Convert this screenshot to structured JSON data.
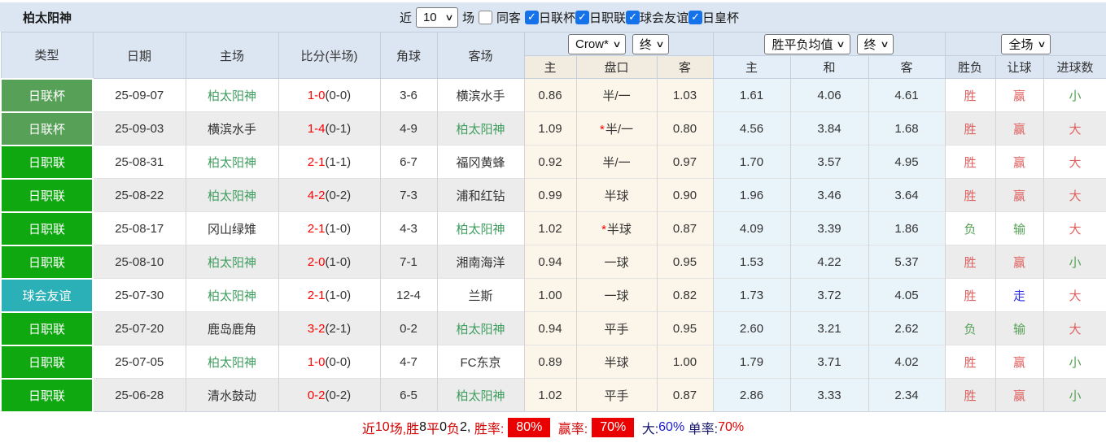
{
  "topbar": {
    "team_title": "柏太阳神",
    "recent_label": "近",
    "recent_value": "10",
    "games_label": "场",
    "same_away_label": "同客",
    "same_away_checked": false,
    "leagues": [
      {
        "label": "日联杯",
        "checked": true
      },
      {
        "label": "日职联",
        "checked": true
      },
      {
        "label": "球会友谊",
        "checked": true
      },
      {
        "label": "日皇杯",
        "checked": true
      }
    ],
    "check_glyph": "✓",
    "chevron_glyph": "∨"
  },
  "header": {
    "col_type": "类型",
    "col_date": "日期",
    "col_home": "主场",
    "col_score": "比分(半场)",
    "col_corner": "角球",
    "col_away": "客场",
    "odds_company_select": "Crow*",
    "odds_time_select": "终",
    "avg_select": "胜平负均值",
    "avg_time_select": "终",
    "result_select": "全场",
    "odds_sub": [
      "主",
      "盘口",
      "客"
    ],
    "avg_sub": [
      "主",
      "和",
      "客"
    ],
    "result_sub": [
      "胜负",
      "让球",
      "进球数"
    ]
  },
  "colors": {
    "type_badges": {
      "日联杯": "#57a057",
      "日职联": "#10a810",
      "球会友谊": "#2ab0b6"
    },
    "subject_team": "#3f9e5f",
    "score_red": "#fe0000",
    "result_red": "#e06060",
    "result_green": "#55a055",
    "result_blue": "#2a2ae0",
    "badge_bg": "#ea0000"
  },
  "rows": [
    {
      "type": "日联杯",
      "date": "25-09-07",
      "home": "柏太阳神",
      "home_subject": true,
      "ft": "1-0",
      "ht": "(0-0)",
      "corner": "3-6",
      "away": "横滨水手",
      "away_subject": false,
      "o1": "0.86",
      "line": "半/一",
      "star": false,
      "o2": "1.03",
      "a1": "1.61",
      "a2": "4.06",
      "a3": "4.61",
      "res": {
        "t": "胜",
        "c": "r"
      },
      "hres": {
        "t": "赢",
        "c": "r"
      },
      "gres": {
        "t": "小",
        "c": "g"
      }
    },
    {
      "type": "日联杯",
      "date": "25-09-03",
      "home": "横滨水手",
      "home_subject": false,
      "ft": "1-4",
      "ht": "(0-1)",
      "corner": "4-9",
      "away": "柏太阳神",
      "away_subject": true,
      "o1": "1.09",
      "line": "半/一",
      "star": true,
      "o2": "0.80",
      "a1": "4.56",
      "a2": "3.84",
      "a3": "1.68",
      "res": {
        "t": "胜",
        "c": "r"
      },
      "hres": {
        "t": "赢",
        "c": "r"
      },
      "gres": {
        "t": "大",
        "c": "r"
      }
    },
    {
      "type": "日职联",
      "date": "25-08-31",
      "home": "柏太阳神",
      "home_subject": true,
      "ft": "2-1",
      "ht": "(1-1)",
      "corner": "6-7",
      "away": "福冈黄蜂",
      "away_subject": false,
      "o1": "0.92",
      "line": "半/一",
      "star": false,
      "o2": "0.97",
      "a1": "1.70",
      "a2": "3.57",
      "a3": "4.95",
      "res": {
        "t": "胜",
        "c": "r"
      },
      "hres": {
        "t": "赢",
        "c": "r"
      },
      "gres": {
        "t": "大",
        "c": "r"
      }
    },
    {
      "type": "日职联",
      "date": "25-08-22",
      "home": "柏太阳神",
      "home_subject": true,
      "ft": "4-2",
      "ht": "(0-2)",
      "corner": "7-3",
      "away": "浦和红钻",
      "away_subject": false,
      "o1": "0.99",
      "line": "半球",
      "star": false,
      "o2": "0.90",
      "a1": "1.96",
      "a2": "3.46",
      "a3": "3.64",
      "res": {
        "t": "胜",
        "c": "r"
      },
      "hres": {
        "t": "赢",
        "c": "r"
      },
      "gres": {
        "t": "大",
        "c": "r"
      }
    },
    {
      "type": "日职联",
      "date": "25-08-17",
      "home": "冈山绿雉",
      "home_subject": false,
      "ft": "2-1",
      "ht": "(1-0)",
      "corner": "4-3",
      "away": "柏太阳神",
      "away_subject": true,
      "o1": "1.02",
      "line": "半球",
      "star": true,
      "o2": "0.87",
      "a1": "4.09",
      "a2": "3.39",
      "a3": "1.86",
      "res": {
        "t": "负",
        "c": "g"
      },
      "hres": {
        "t": "输",
        "c": "g"
      },
      "gres": {
        "t": "大",
        "c": "r"
      }
    },
    {
      "type": "日职联",
      "date": "25-08-10",
      "home": "柏太阳神",
      "home_subject": true,
      "ft": "2-0",
      "ht": "(1-0)",
      "corner": "7-1",
      "away": "湘南海洋",
      "away_subject": false,
      "o1": "0.94",
      "line": "一球",
      "star": false,
      "o2": "0.95",
      "a1": "1.53",
      "a2": "4.22",
      "a3": "5.37",
      "res": {
        "t": "胜",
        "c": "r"
      },
      "hres": {
        "t": "赢",
        "c": "r"
      },
      "gres": {
        "t": "小",
        "c": "g"
      }
    },
    {
      "type": "球会友谊",
      "date": "25-07-30",
      "home": "柏太阳神",
      "home_subject": true,
      "ft": "2-1",
      "ht": "(1-0)",
      "corner": "12-4",
      "away": "兰斯",
      "away_subject": false,
      "o1": "1.00",
      "line": "一球",
      "star": false,
      "o2": "0.82",
      "a1": "1.73",
      "a2": "3.72",
      "a3": "4.05",
      "res": {
        "t": "胜",
        "c": "r"
      },
      "hres": {
        "t": "走",
        "c": "b"
      },
      "gres": {
        "t": "大",
        "c": "r"
      }
    },
    {
      "type": "日职联",
      "date": "25-07-20",
      "home": "鹿岛鹿角",
      "home_subject": false,
      "ft": "3-2",
      "ht": "(2-1)",
      "corner": "0-2",
      "away": "柏太阳神",
      "away_subject": true,
      "o1": "0.94",
      "line": "平手",
      "star": false,
      "o2": "0.95",
      "a1": "2.60",
      "a2": "3.21",
      "a3": "2.62",
      "res": {
        "t": "负",
        "c": "g"
      },
      "hres": {
        "t": "输",
        "c": "g"
      },
      "gres": {
        "t": "大",
        "c": "r"
      }
    },
    {
      "type": "日职联",
      "date": "25-07-05",
      "home": "柏太阳神",
      "home_subject": true,
      "ft": "1-0",
      "ht": "(0-0)",
      "corner": "4-7",
      "away": "FC东京",
      "away_subject": false,
      "o1": "0.89",
      "line": "半球",
      "star": false,
      "o2": "1.00",
      "a1": "1.79",
      "a2": "3.71",
      "a3": "4.02",
      "res": {
        "t": "胜",
        "c": "r"
      },
      "hres": {
        "t": "赢",
        "c": "r"
      },
      "gres": {
        "t": "小",
        "c": "g"
      }
    },
    {
      "type": "日职联",
      "date": "25-06-28",
      "home": "清水鼓动",
      "home_subject": false,
      "ft": "0-2",
      "ht": "(0-2)",
      "corner": "6-5",
      "away": "柏太阳神",
      "away_subject": true,
      "o1": "1.02",
      "line": "平手",
      "star": false,
      "o2": "0.87",
      "a1": "2.86",
      "a2": "3.33",
      "a3": "2.34",
      "res": {
        "t": "胜",
        "c": "r"
      },
      "hres": {
        "t": "赢",
        "c": "r"
      },
      "gres": {
        "t": "小",
        "c": "g"
      }
    }
  ],
  "footer": {
    "segments": [
      {
        "t": "近",
        "c": "red"
      },
      {
        "t": "10",
        "c": "red"
      },
      {
        "t": "场,",
        "c": "red"
      },
      {
        "t": "胜",
        "c": "red"
      },
      {
        "t": "8",
        "c": "dark"
      },
      {
        "t": "平",
        "c": "red"
      },
      {
        "t": "0",
        "c": "dark"
      },
      {
        "t": "负",
        "c": "red"
      },
      {
        "t": "2",
        "c": "dark"
      },
      {
        "t": ", ",
        "c": "dark"
      },
      {
        "t": "胜率:",
        "c": "red"
      },
      {
        "t": "80%",
        "c": "badge"
      },
      {
        "t": " ",
        "c": "dark"
      },
      {
        "t": "赢率:",
        "c": "red"
      },
      {
        "t": "70%",
        "c": "badge"
      },
      {
        "t": " ",
        "c": "dark"
      },
      {
        "t": "大:",
        "c": "navy"
      },
      {
        "t": "60%",
        "c": "blue"
      },
      {
        "t": " ",
        "c": "dark"
      },
      {
        "t": "单率:",
        "c": "navy"
      },
      {
        "t": "70%",
        "c": "redval"
      }
    ]
  }
}
